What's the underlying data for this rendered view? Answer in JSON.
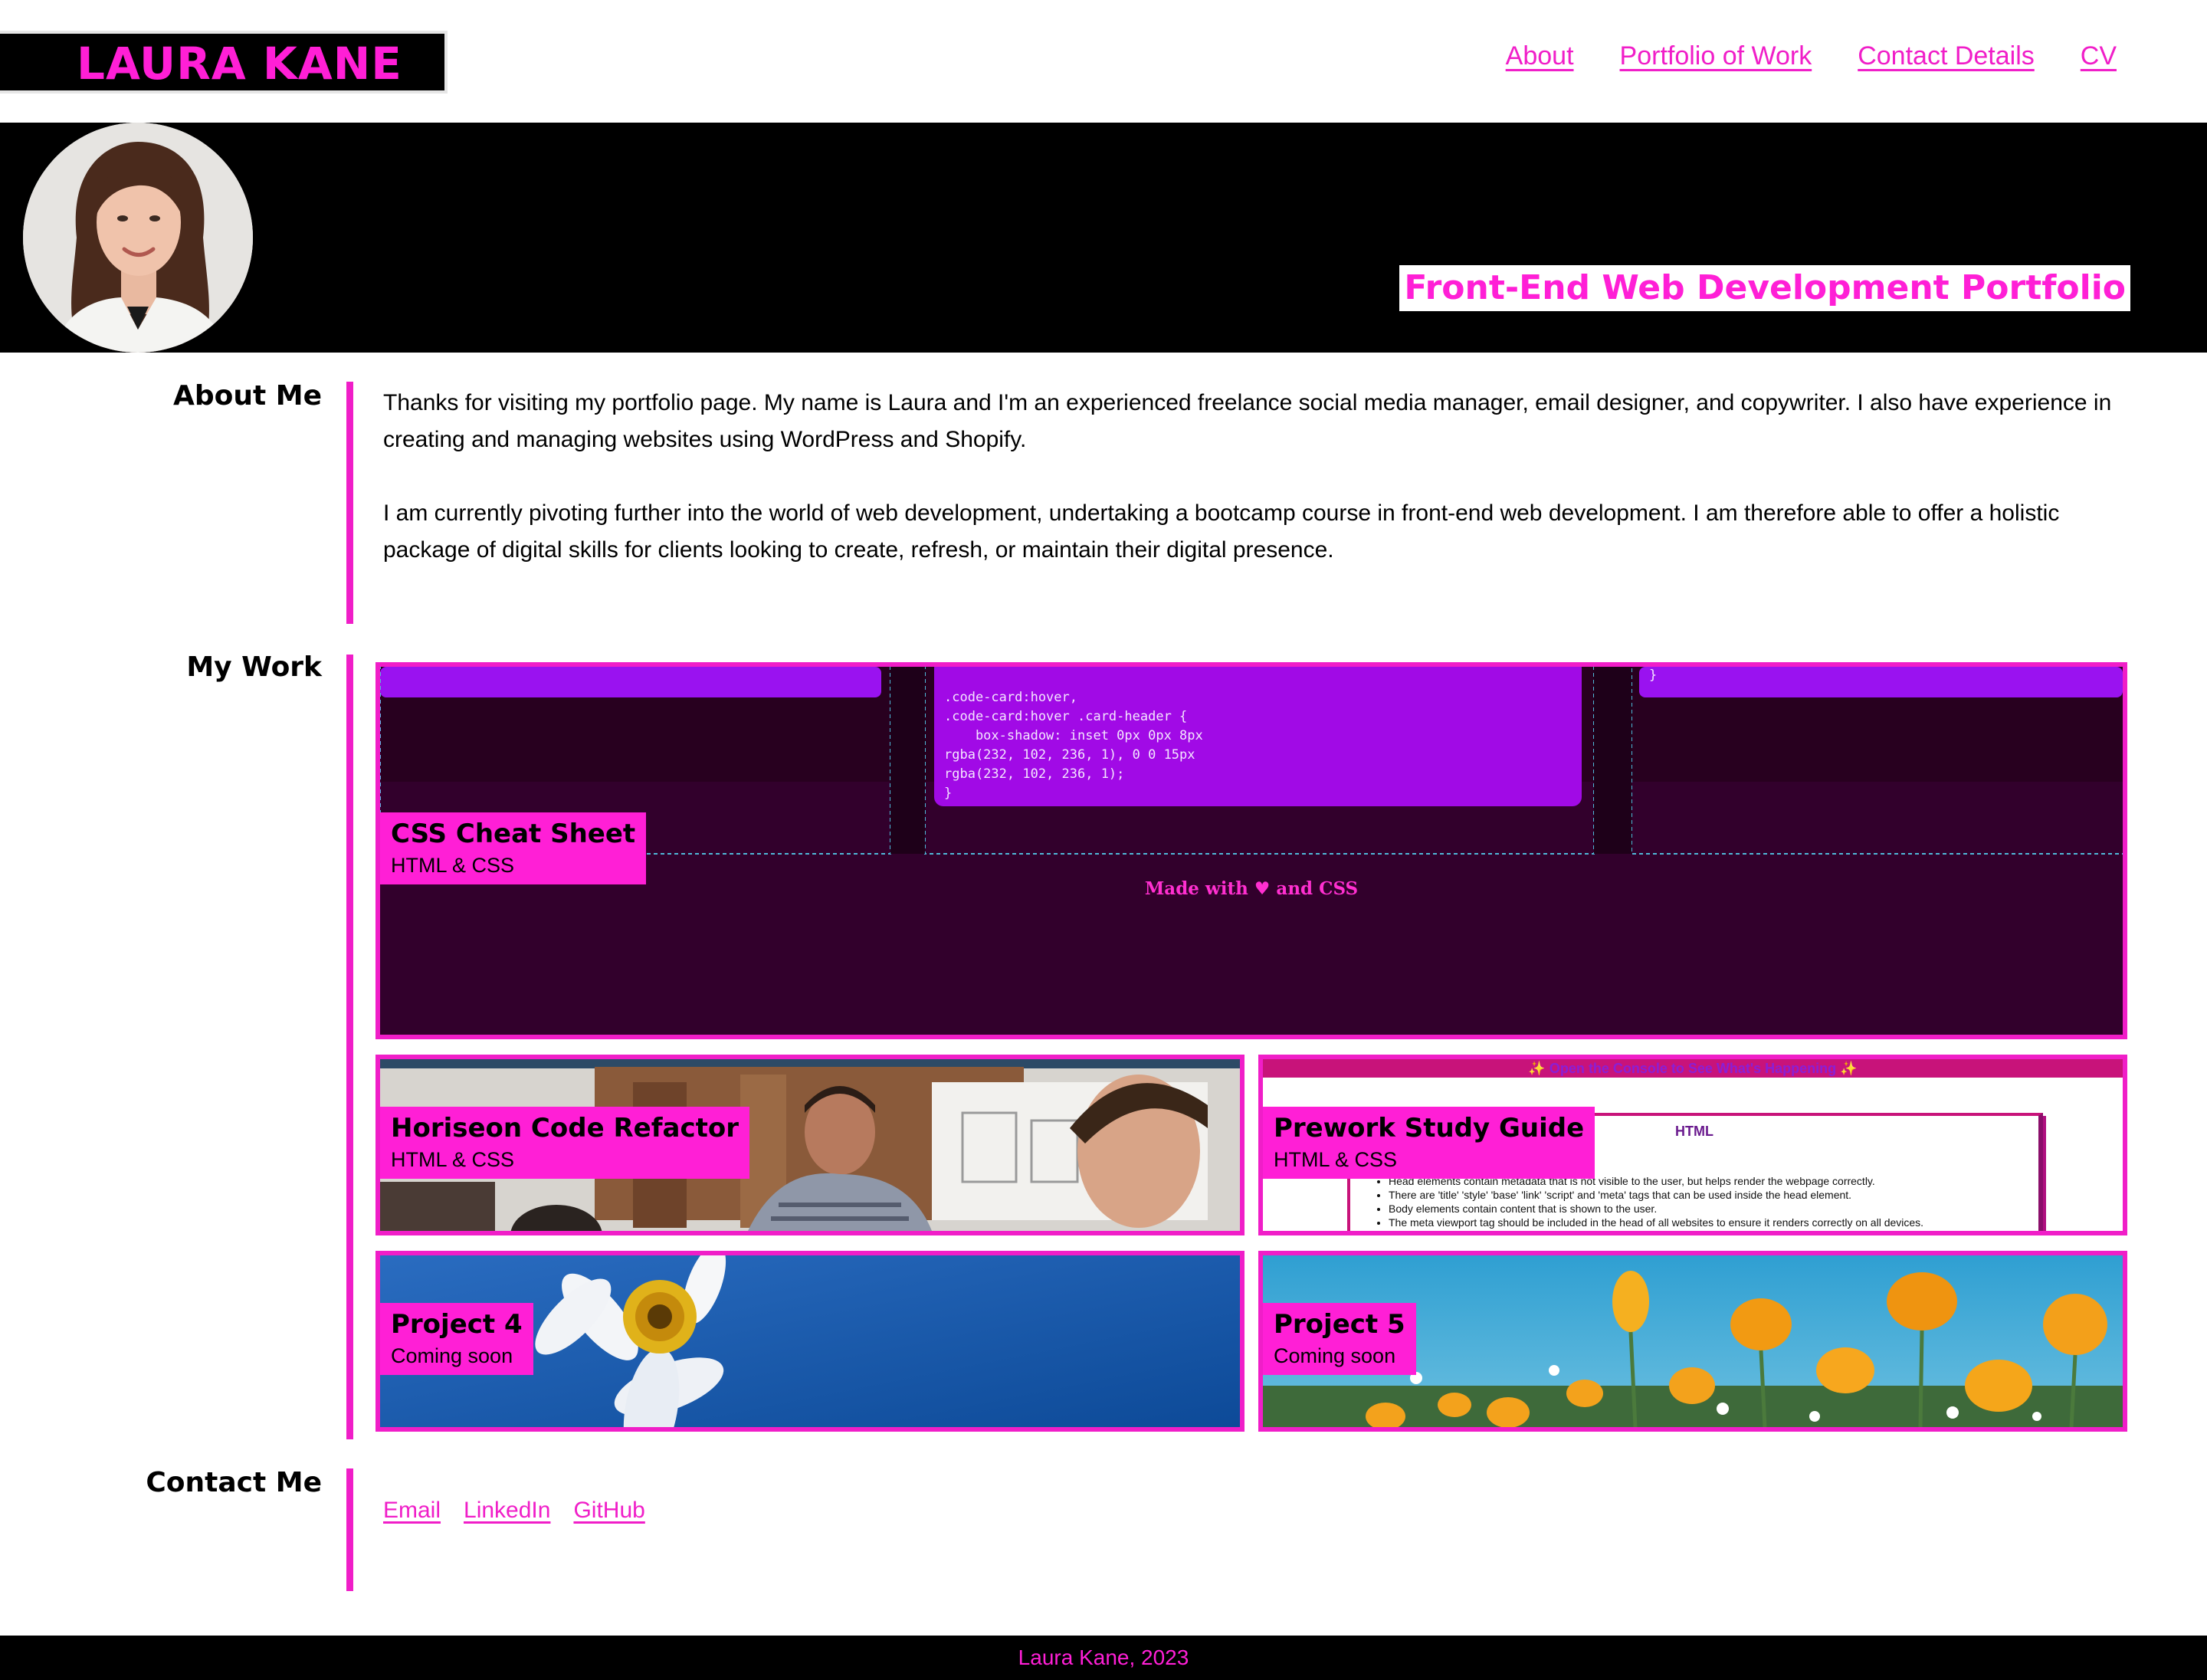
{
  "header": {
    "logo": "LAURA KANE",
    "nav": [
      "About",
      "Portfolio of Work",
      "Contact Details",
      "CV"
    ]
  },
  "hero": {
    "title": "Front-End Web Development Portfolio"
  },
  "about": {
    "heading": "About Me",
    "paragraphs": [
      "Thanks for visiting my portfolio page. My name is Laura and I'm an experienced freelance social media manager, email designer, and copywriter. I also have experience in creating and managing websites using WordPress and Shopify.",
      "I am currently pivoting further into the world of web development, undertaking a bootcamp course in front-end web development. I am therefore able to offer a holistic package of digital skills for clients looking to create, refresh, or maintain their digital presence."
    ]
  },
  "work": {
    "heading": "My Work",
    "projects": [
      {
        "title": "CSS Cheat Sheet",
        "subtitle": "HTML & CSS",
        "preview_code": [
          ".code-card:hover,",
          ".code-card:hover .card-header {",
          "    box-shadow: inset 0px 0px 8px",
          "rgba(232, 102, 236, 1), 0 0 15px",
          "rgba(232, 102, 236, 1);",
          "}"
        ],
        "preview_brace": "}",
        "preview_footer": "Made with ♥ and CSS"
      },
      {
        "title": "Horiseon Code Refactor",
        "subtitle": "HTML & CSS"
      },
      {
        "title": "Prework Study Guide",
        "subtitle": "HTML & CSS",
        "preview_banner": "✨ Open the Console to See What's Happening ✨",
        "preview_heading": "HTML",
        "preview_partial": "e.",
        "preview_items": [
          "Head elements contain metadata that is not visible to the user, but helps render the webpage correctly.",
          "There are 'title' 'style' 'base' 'link' 'script' and 'meta' tags that can be used inside the head element.",
          "Body elements contain content that is shown to the user.",
          "The meta viewport tag should be included in the head of all websites to ensure it renders correctly on all devices."
        ]
      },
      {
        "title": "Project 4",
        "subtitle": "Coming soon"
      },
      {
        "title": "Project 5",
        "subtitle": "Coming soon"
      }
    ]
  },
  "contact": {
    "heading": "Contact Me",
    "links": [
      "Email",
      "LinkedIn",
      "GitHub"
    ]
  },
  "footer": {
    "text": "Laura Kane, 2023"
  },
  "colors": {
    "accent": "#ff1fd6",
    "link": "#f01ec8",
    "background": "#ffffff",
    "band": "#000000"
  },
  "icons": [
    "avatar-photo",
    "heart-icon"
  ]
}
